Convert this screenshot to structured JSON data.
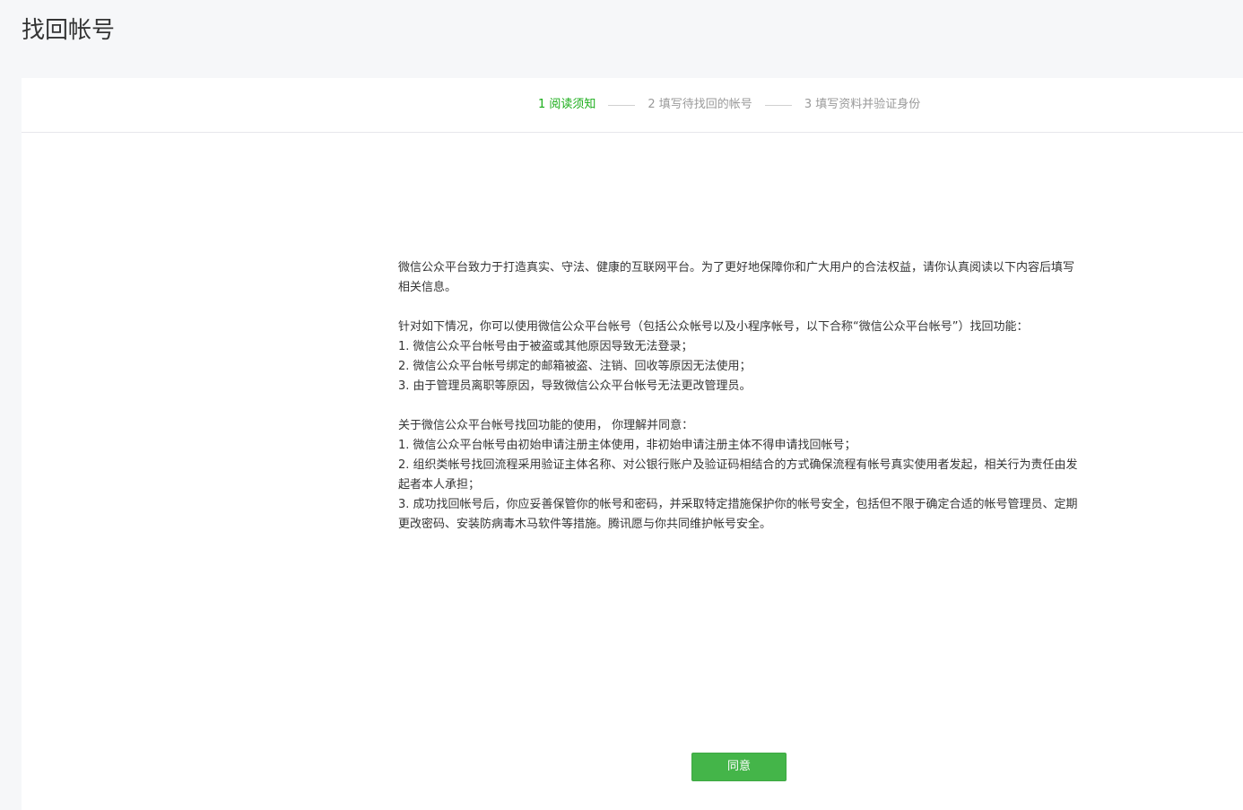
{
  "header": {
    "title": "找回帐号"
  },
  "steps": [
    {
      "label": "1 阅读须知",
      "active": true
    },
    {
      "label": "2 填写待找回的帐号",
      "active": false
    },
    {
      "label": "3 填写资料并验证身份",
      "active": false
    }
  ],
  "content": {
    "intro": "微信公众平台致力于打造真实、守法、健康的互联网平台。为了更好地保障你和广大用户的合法权益，请你认真阅读以下内容后填写相关信息。",
    "section1_title": "针对如下情况，你可以使用微信公众平台帐号（包括公众帐号以及小程序帐号，以下合称“微信公众平台帐号”）找回功能：",
    "section1_items": [
      "1. 微信公众平台帐号由于被盗或其他原因导致无法登录；",
      "2. 微信公众平台帐号绑定的邮箱被盗、注销、回收等原因无法使用；",
      "3. 由于管理员离职等原因，导致微信公众平台帐号无法更改管理员。"
    ],
    "section2_title": "关于微信公众平台帐号找回功能的使用， 你理解并同意：",
    "section2_items": [
      "1. 微信公众平台帐号由初始申请注册主体使用，非初始申请注册主体不得申请找回帐号；",
      "2. 组织类帐号找回流程采用验证主体名称、对公银行账户及验证码相结合的方式确保流程有帐号真实使用者发起，相关行为责任由发起者本人承担；",
      "3. 成功找回帐号后，你应妥善保管你的帐号和密码，并采取特定措施保护你的帐号安全，包括但不限于确定合适的帐号管理员、定期更改密码、安装防病毒木马软件等措施。腾讯愿与你共同维护帐号安全。"
    ]
  },
  "actions": {
    "agree_label": "同意"
  },
  "colors": {
    "accent": "#1aad19",
    "button": "#44b549"
  }
}
